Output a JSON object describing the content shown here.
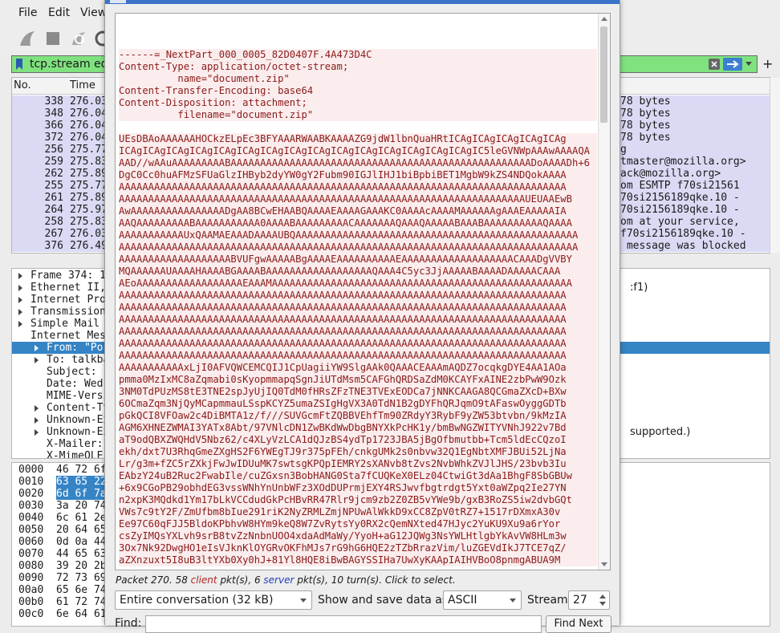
{
  "menu": {
    "file": "File",
    "edit": "Edit",
    "view": "View"
  },
  "filter": {
    "value": "tcp.stream eq"
  },
  "packet_list": {
    "columns": [
      "No.",
      "Time"
    ],
    "rows": [
      {
        "no": "338",
        "time": "276.03",
        "info": "78 bytes"
      },
      {
        "no": "348",
        "time": "276.04",
        "info": "78 bytes"
      },
      {
        "no": "366",
        "time": "276.04",
        "info": "78 bytes"
      },
      {
        "no": "372",
        "time": "276.04",
        "info": "78 bytes"
      },
      {
        "no": "256",
        "time": "275.77",
        "info": "g"
      },
      {
        "no": "259",
        "time": "275.83",
        "info": "tmaster@mozilla.org>"
      },
      {
        "no": "262",
        "time": "275.89",
        "info": "ack@mozilla.org>"
      },
      {
        "no": "255",
        "time": "275.77",
        "info": "om ESMTP f70si21561"
      },
      {
        "no": "261",
        "time": "275.89",
        "info": "70si2156189qke.10 -"
      },
      {
        "no": "264",
        "time": "275.97",
        "info": "70si2156189qke.10 -"
      },
      {
        "no": "258",
        "time": "275.83",
        "info": "om at your service,"
      },
      {
        "no": "267",
        "time": "276.03",
        "info": "f70si2156189qke.10 -"
      },
      {
        "no": "376",
        "time": "276.49",
        "info": " message was blocked"
      }
    ]
  },
  "details": {
    "rows": [
      "Frame 374: 1",
      "Ethernet II,",
      "Internet Pro",
      "Transmission",
      "Simple Mail",
      "Internet Mes",
      "From: \"Pos",
      "To: talkba",
      "Subject: ",
      "Date: Wed,",
      "MIME-Versi",
      "Content-Ty",
      "Unknown-Ex",
      "Unknown-Ex",
      "X-Mailer: ",
      "X-MimeOLE"
    ],
    "right_fragments": [
      ":f1)",
      "supported.)"
    ]
  },
  "bytes": {
    "rows": [
      {
        "offset": "0000",
        "hex": "46 72 6f"
      },
      {
        "offset": "0010",
        "hex": "63 65 22"
      },
      {
        "offset": "0020",
        "hex": "6d 6f 7a"
      },
      {
        "offset": "0030",
        "hex": "3a 20 74"
      },
      {
        "offset": "0040",
        "hex": "6c 61 2e"
      },
      {
        "offset": "0050",
        "hex": "20 64 65"
      },
      {
        "offset": "0060",
        "hex": "0d 0a 44"
      },
      {
        "offset": "0070",
        "hex": "44 65 63"
      },
      {
        "offset": "0080",
        "hex": "39 20 2b"
      },
      {
        "offset": "0090",
        "hex": "72 73 69"
      },
      {
        "offset": "00a0",
        "hex": "65 6e 74"
      },
      {
        "offset": "00b0",
        "hex": "61 72 74"
      },
      {
        "offset": "00c0",
        "hex": "6e 64 61"
      }
    ]
  },
  "follow_stream": {
    "header_lines": [
      "------=_NextPart_000_0005_82D0407F.4A473D4C",
      "Content-Type: application/octet-stream;",
      "          name=\"document.zip\"",
      "Content-Transfer-Encoding: base64",
      "Content-Disposition: attachment;",
      "          filename=\"document.zip\""
    ],
    "base64_lines": [
      "UEsDBAoAAAAAAHOCkzELpEc3BFYAAARWAABKAAAAZG9jdW1lbnQuaHRtICAgICAgICAgICAgICAg",
      "ICAgICAgICAgICAgICAgICAgICAgICAgICAgICAgICAgICAgICAgICAgICAgIC5leGVNWpAAAwAAAAQA",
      "AAD//wAAuAAAAAAAAABAAAAAAAAAAAAAAAAAAAAAAAAAAAAAAAAAAAAAAAAAAAAAAAAAAADoAAAADh+6",
      "DgC0Cc0huAFMzSFUaGlzIHByb2dyYW0gY2Fubm90IGJlIHJ1biBpbiBET1MgbW9kZS4NDQokAAAA",
      "AAAAAAAAAAAAAAAAAAAAAAAAAAAAAAAAAAAAAAAAAAAAAAAAAAAAAAAAAAAAAAAAAAAAAAAAAAAA",
      "AAAAAAAAAAAAAAAAAAAAAAAAAAAAAAAAAAAAAAAAAAAAAAAAAAAAAAAAAAAAAAAAAAAAAUEUAAEwB",
      "AwAAAAAAAAAAAAAAAADgAA8BCwEHAABQAAAAEAAAAGAAAKC0AAAAcAAAAMAAAAAAgAAAEAAAAAIA",
      "AAQAAAAAAAAABAAAAAAAAAAA0AAAABAAAAAAAAACAAAAAAAQAAAQAAAAABAAABAAAAAAAAAAQAAAA",
      "AAAAAAAAAAAUxQAAMAEAAADAAAAUBQAAAAAAAAAAAAAAAAAAAAAAAAAAAAAAAAAAAAAAAAAAAAAAAA",
      "AAAAAAAAAAAAAAAAAAAAAAAAAAAAAAAAAAAAAAAAAAAAAAAAAAAAAAAAAAAAAAAAAAAAAAAAAAAAAA",
      "AAAAAAAAAAAAAAAAAAABVUFgwAAAAABgAAAAEAAAAAAAAAAEAAAAAAAAAAAAAAAAAAACAAADgVVBY",
      "MQAAAAAAUAAAAHAAAABGAAAABAAAAAAAAAAAAAAAAAAQAAA4C5yc3JjAAAAABAAAADAAAAACAAA",
      "AEoAAAAAAAAAAAAAAAAAAEAAAMAAAAAAAAAAAAAAAAAAAAAAAAAAAAAAAAAAAAAAAAAAAAAAAAAAA",
      "AAAAAAAAAAAAAAAAAAAAAAAAAAAAAAAAAAAAAAAAAAAAAAAAAAAAAAAAAAAAAAAAAAAAAAAAAAAA",
      "AAAAAAAAAAAAAAAAAAAAAAAAAAAAAAAAAAAAAAAAAAAAAAAAAAAAAAAAAAAAAAAAAAAAAAAAAAAA",
      "AAAAAAAAAAAAAAAAAAAAAAAAAAAAAAAAAAAAAAAAAAAAAAAAAAAAAAAAAAAAAAAAAAAAAAAAAAAA",
      "AAAAAAAAAAAAAAAAAAAAAAAAAAAAAAAAAAAAAAAAAAAAAAAAAAAAAAAAAAAAAAAAAAAAAAAAAAAA",
      "AAAAAAAAAAAAAAAAAAAAAAAAAAAAAAAAAAAAAAAAAAAAAAAAAAAAAAAAAAAAAAAAAAAAAAAAAAAA",
      "AAAAAAAAAAAAAAAAAAAAAAAAAAAAAAAAAAAAAAAAAAAAAAAAAAAAAAAAAAAAAAAAAAAAAAAAAAAA",
      "AAAAAAAAAAAxLjI0AFVQWCEMCQIJ1CpUagiiYW9SlgAAk0QAAACEAAAmAQDZ7ocqkgDYE4AA1AOa",
      "pmma0MzIxMC8aZqmabi0sKyopmmapqSgnJiUTdMsm5CAFGhQRDSaZdM0KCAYFxAINE2zbPwW9Ozk",
      "3NM0TdPUzMS8tE3TNE2spJyUjIQ0TdM0fHRsZFzTNE3TVExEODCa7jNNKCAAGA8QCGmaZXcD+BXw",
      "6OCmaZqm3NjQyMCapmmauLSspKCYZ5umaZSIgHgVX3A0TdN1B2gDYFhQRJqmO9tAFaswOyggGDTb",
      "pGkQCI8VFOaw2c4DiBMTA1z/f///SUVGcmFtZQBBVEhfTm90ZRdyY3RybF9yZW53btvbn/9kMzIA",
      "AGM6XHNEZWMAI3YATx8Abt/97VNlcDN1ZwBKdWwDbgBNYXkPcHK1y/bmBwNGZWITYVNhJ922v7Bd",
      "aT9odQBXZWQHdV5Nbz62/c4XLyVzLCA1dQJzBS4ydTp1723JBA5jBgOfbmutbb+Tcm5ldEcCQzoI",
      "ekh/dxt7U3RhqGmeZXgHS2F6YWEgTJ9r375pFEh/cnkgUMk2s0nbvw32Q1EgNbtXMFJBUi52LjNa",
      "Lr/g3m+fZC5rZXkjFwJwIDUuMK7swtsgKPQpIEMRY2sXANvb8tZvs2NvbWhkZVJlJHS/23bvb3Iu",
      "EAbzY24uB2Ruc2FwabIle/cuZGxsn3BobHANG0Sta7fCUQKeX0ELz04CtwiGt3dAa1BhgF8SbGBUw",
      "+6x9CGoPB29obhdEG3vssWNhYnUnbWFz3XOdDUPrmjEXY4RSJwvfbgtrdgt5Yxt0aWZpq2Ie27YN",
      "n2xpK3MQdkd1Ym17bLkVCCdudGkPcHBvRR47Rlr9jcm9zb2Z0ZB5vYWe9b/gxB3RoZS5iw2dvbGQt",
      "VWs7c9tY2F/ZmUfbm8bIue291riK2NyZRMLZmjNPUwAlWkkD9xCC8ZpV0tRZ7+1517rDXmxA30v",
      "Ee97C60qFJJ5BldoKPbhvW8HYm9keQ8W7ZvRytsYy0RX2cQemNXted47HJyc2YuKU9Xu9a6rYor",
      "csZyIMQsYXLvh9srB8tvZzNnbnUOO4xdaAdMaWy/YyoH+aG12JQWg3NsYWLHtlgbYkAvVW8HLm3w",
      "3Ox7Nk92DwgHO1eIsVJknKlOYGRvOKFhMJs7rG9hG6HQE2zTZbRrazVim/luZGEVdIkJ7TCE7qZ/",
      "aZXnzuxt5I8uB3ltYXb0Xy0hJ+81Yl8HQE8iBwBAGYSSIHa7UwXyKAApIAIHVBoO8pnmgABUA9M"
    ]
  },
  "status": {
    "prefix": "Packet 270. 58 ",
    "client_word": "client",
    "middle": " pkt(s), 6 ",
    "server_word": "server",
    "suffix": " pkt(s), 10 turn(s). Click to select."
  },
  "controls": {
    "conversation_select": "Entire conversation (32 kB)",
    "show_save_label": "Show and save data as",
    "format_select": "ASCII",
    "stream_label": "Stream",
    "stream_value": "27",
    "find_label": "Find:",
    "find_next_button": "Find Next"
  }
}
